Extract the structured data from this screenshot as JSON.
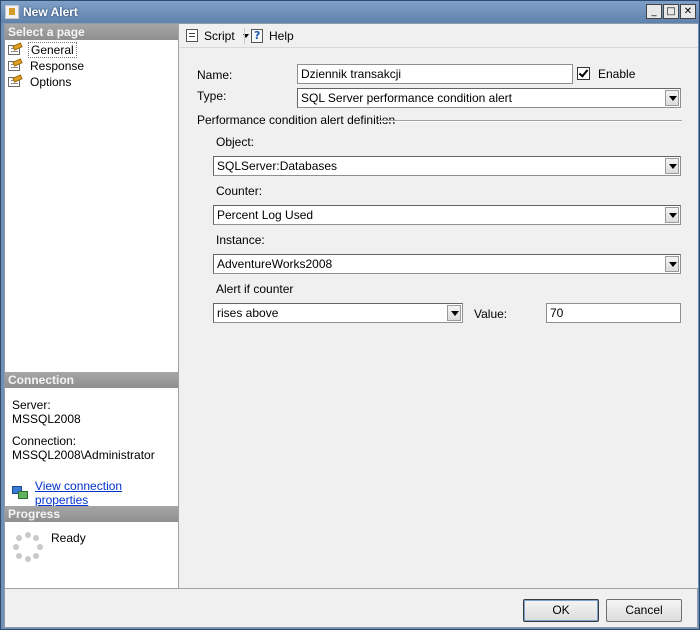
{
  "window": {
    "title": "New Alert",
    "minimize_glyph": "_",
    "maximize_glyph": "□",
    "close_glyph": "✕"
  },
  "sidebar": {
    "select_page_header": "Select a page",
    "pages": [
      {
        "label": "General",
        "icon": "page-settings-icon",
        "selected": true
      },
      {
        "label": "Response",
        "icon": "page-settings-icon",
        "selected": false
      },
      {
        "label": "Options",
        "icon": "page-settings-icon",
        "selected": false
      }
    ],
    "connection_header": "Connection",
    "server_label": "Server:",
    "server_value": "MSSQL2008",
    "connection_label": "Connection:",
    "connection_value": "MSSQL2008\\Administrator",
    "view_connection_link": "View connection properties",
    "progress_header": "Progress",
    "progress_status": "Ready"
  },
  "toolbar": {
    "script_label": "Script",
    "help_label": "Help"
  },
  "form": {
    "name_label": "Name:",
    "name_value": "Dziennik transakcji",
    "enable_label": "Enable",
    "enable_checked": true,
    "type_label": "Type:",
    "type_value": "SQL Server performance condition alert",
    "group_title": "Performance condition alert definition",
    "object_label": "Object:",
    "object_value": "SQLServer:Databases",
    "counter_label": "Counter:",
    "counter_value": "Percent Log Used",
    "instance_label": "Instance:",
    "instance_value": "AdventureWorks2008",
    "alert_if_label": "Alert if counter",
    "alert_if_value": "rises above",
    "value_label": "Value:",
    "value_value": "70"
  },
  "buttons": {
    "ok": "OK",
    "cancel": "Cancel"
  },
  "colors": {
    "title_bar": "#6f8fb5",
    "section_header": "#9a9a9a",
    "link": "#0033cc"
  }
}
